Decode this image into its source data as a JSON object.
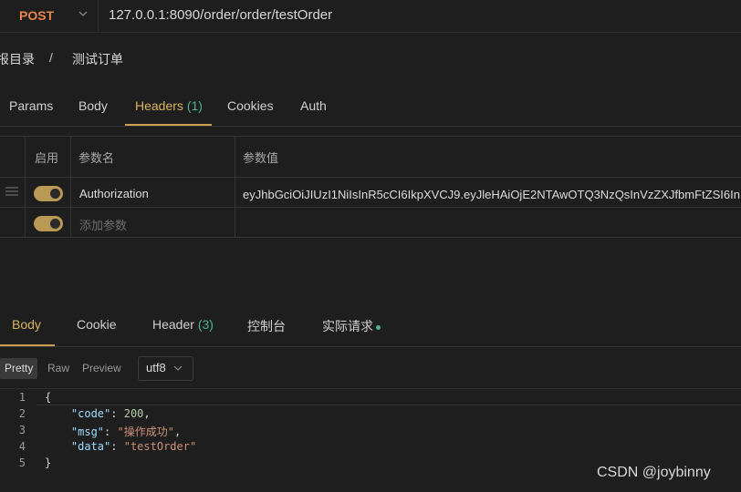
{
  "request": {
    "method": "POST",
    "url": "127.0.0.1:8090/order/order/testOrder"
  },
  "breadcrumb": {
    "root": "报目录",
    "separator": "/",
    "current": "测试订单"
  },
  "request_tabs": {
    "params": "Params",
    "body": "Body",
    "headers": "Headers",
    "headers_count": "(1)",
    "cookies": "Cookies",
    "auth": "Auth"
  },
  "headers_table": {
    "col_enabled": "启用",
    "col_name": "参数名",
    "col_value": "参数值",
    "rows": [
      {
        "enabled": true,
        "name": "Authorization",
        "value": "eyJhbGciOiJIUzI1NiIsInR5cCI6IkpXVCJ9.eyJleHAiOjE2NTAwOTQ3NzQsInVzZXJfbmFtZSI6In"
      }
    ],
    "add_placeholder": "添加参数"
  },
  "response_tabs": {
    "body": "Body",
    "cookie": "Cookie",
    "header": "Header",
    "header_count": "(3)",
    "console": "控制台",
    "actual_request": "实际请求"
  },
  "format": {
    "pretty": "Pretty",
    "raw": "Raw",
    "preview": "Preview",
    "encoding": "utf8"
  },
  "response_body": {
    "line_numbers": [
      "1",
      "2",
      "3",
      "4",
      "5"
    ],
    "open_brace": "{",
    "close_brace": "}",
    "code_key": "\"code\"",
    "code_value": "200",
    "msg_key": "\"msg\"",
    "msg_value": "\"操作成功\"",
    "data_key": "\"data\"",
    "data_value": "\"testOrder\""
  },
  "watermark": "CSDN @joybinny",
  "colors": {
    "accent": "#c9a14e",
    "method": "#e8844a",
    "count": "#4fb38c",
    "background": "#1e1e1e"
  }
}
